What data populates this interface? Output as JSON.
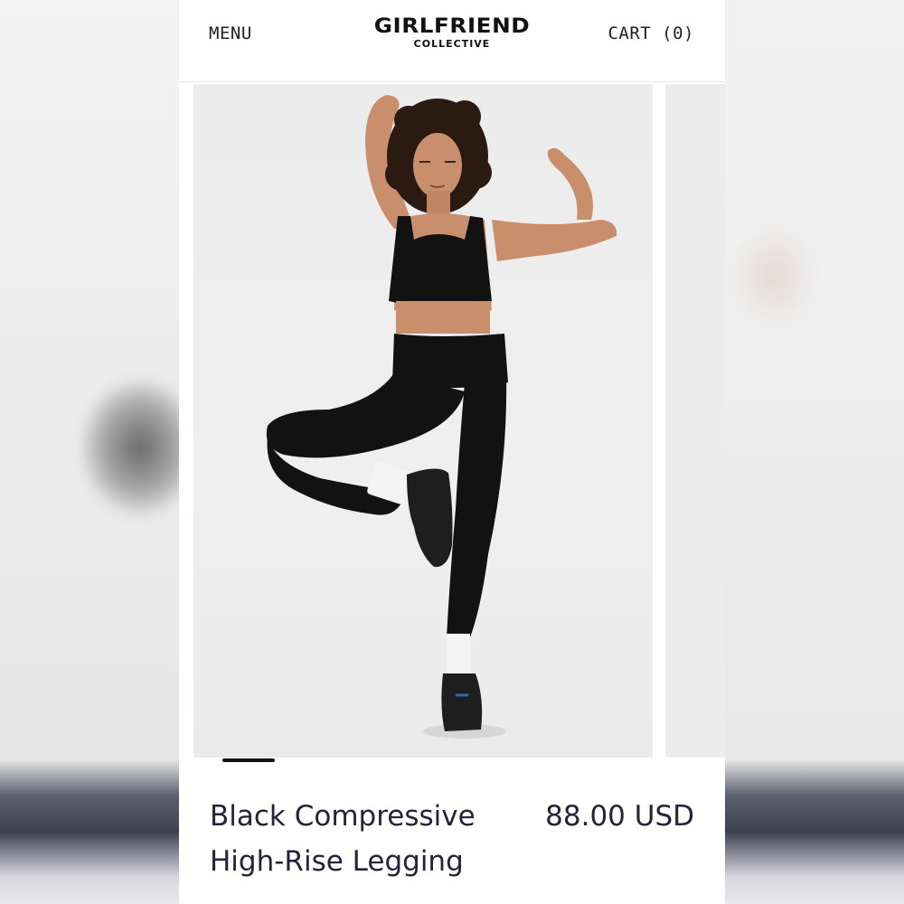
{
  "header": {
    "menu_label": "MENU",
    "cart_label": "CART (0)",
    "logo_top": "GIRLFRIEND",
    "logo_bottom": "COLLECTIVE"
  },
  "carousel": {
    "active_index": 0,
    "image_alt_icon": "product-photo-icon"
  },
  "product": {
    "title_line1": "Black Compressive",
    "title_line2": "High-Rise Legging",
    "price": "88.00 USD"
  },
  "colors": {
    "text": "#23233a",
    "background": "#ffffff",
    "photo_bg": "#ececec",
    "garment": "#121212",
    "skin": "#c98f6c"
  }
}
